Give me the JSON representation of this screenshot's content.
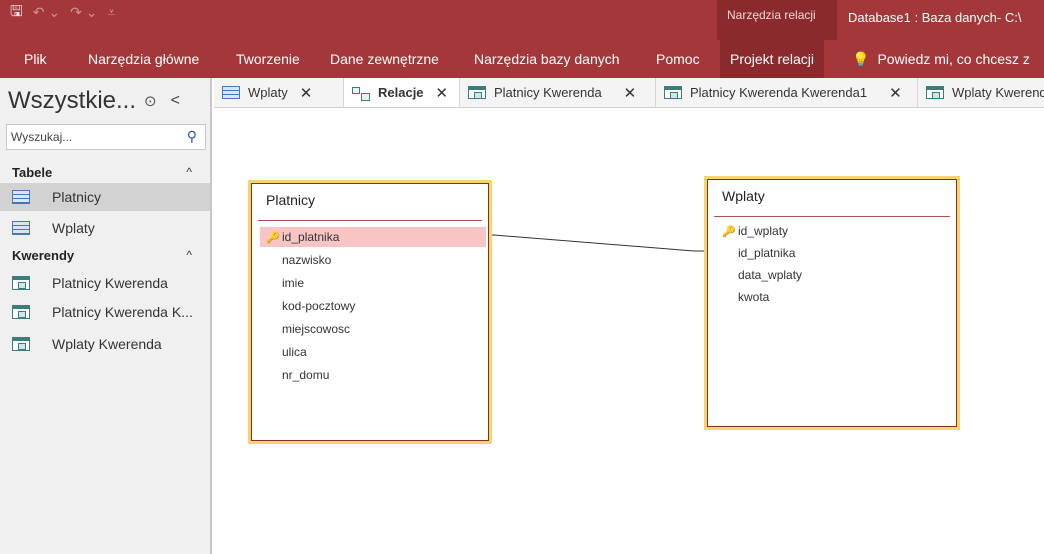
{
  "titlebar": {
    "qat": {
      "save_icon": "save-icon",
      "undo_icon": "undo-icon",
      "redo_icon": "redo-icon",
      "customize_icon": "customize-icon"
    },
    "context_group": "Narzędzia relacji",
    "document_title": "Database1 : Baza danych- C:\\"
  },
  "ribbon": {
    "tabs": [
      "Plik",
      "Narzędzia główne",
      "Tworzenie",
      "Dane zewnętrzne",
      "Narzędzia bazy danych",
      "Pomoc",
      "Projekt relacji"
    ],
    "tell_me": "Powiedz mi, co chcesz z"
  },
  "nav": {
    "title": "Wszystkie...",
    "search_placeholder": "Wyszukaj...",
    "groups": [
      {
        "label": "Tabele",
        "items": [
          "Platnicy",
          "Wplaty"
        ]
      },
      {
        "label": "Kwerendy",
        "items": [
          "Platnicy Kwerenda",
          "Platnicy Kwerenda K...",
          "Wplaty Kwerenda"
        ]
      }
    ]
  },
  "doc_tabs": [
    {
      "label": "Wplaty",
      "kind": "table"
    },
    {
      "label": "Relacje",
      "kind": "relationships",
      "active": true
    },
    {
      "label": "Platnicy Kwerenda",
      "kind": "query"
    },
    {
      "label": "Platnicy Kwerenda Kwerenda1",
      "kind": "query"
    },
    {
      "label": "Wplaty Kwerend",
      "kind": "query"
    }
  ],
  "relationships": {
    "tables": [
      {
        "name": "Platnicy",
        "fields": [
          "id_platnika",
          "nazwisko",
          "imie",
          "kod-pocztowy",
          "miejscowosc",
          "ulica",
          "nr_domu"
        ],
        "primary_key": "id_platnika"
      },
      {
        "name": "Wplaty",
        "fields": [
          "id_wplaty",
          "id_platnika",
          "data_wplaty",
          "kwota"
        ],
        "primary_key": "id_wplaty"
      }
    ],
    "link": {
      "from": "Platnicy.id_platnika",
      "to": "Wplaty.id_platnika"
    }
  },
  "colors": {
    "ribbon": "#a4373a",
    "context": "#8a2a2d",
    "table_border": "#f6d46a",
    "pk_highlight": "#f9c4c4"
  }
}
